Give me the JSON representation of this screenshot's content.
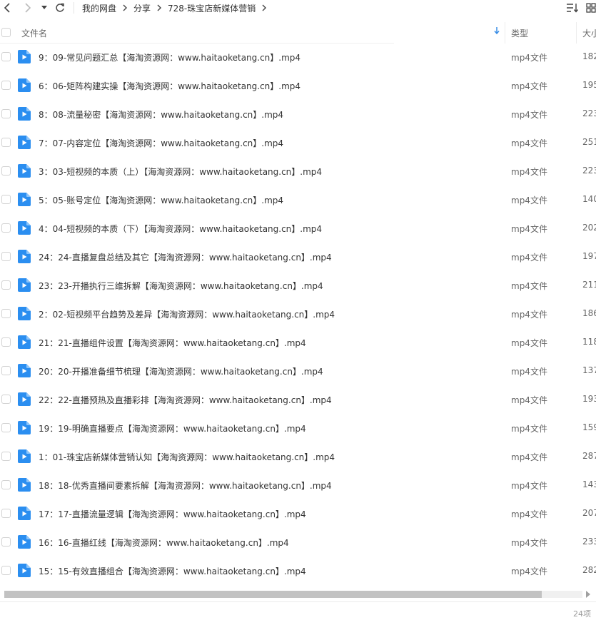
{
  "toolbar": {
    "breadcrumbs": [
      "我的网盘",
      "分享",
      "728-珠宝店新媒体营销"
    ]
  },
  "header": {
    "name_label": "文件名",
    "type_label": "类型",
    "size_label": "大小"
  },
  "files": [
    {
      "name": "9：09-常见问题汇总【海淘资源网：www.haitaoketang.cn】.mp4",
      "type": "mp4文件",
      "size": "182"
    },
    {
      "name": "6：06-矩阵构建实操【海淘资源网：www.haitaoketang.cn】.mp4",
      "type": "mp4文件",
      "size": "195"
    },
    {
      "name": "8：08-流量秘密【海淘资源网：www.haitaoketang.cn】.mp4",
      "type": "mp4文件",
      "size": "223"
    },
    {
      "name": "7：07-内容定位【海淘资源网：www.haitaoketang.cn】.mp4",
      "type": "mp4文件",
      "size": "251"
    },
    {
      "name": "3：03-短视频的本质（上）【海淘资源网：www.haitaoketang.cn】.mp4",
      "type": "mp4文件",
      "size": "223"
    },
    {
      "name": "5：05-账号定位【海淘资源网：www.haitaoketang.cn】.mp4",
      "type": "mp4文件",
      "size": "140"
    },
    {
      "name": "4：04-短视频的本质（下）【海淘资源网：www.haitaoketang.cn】.mp4",
      "type": "mp4文件",
      "size": "202"
    },
    {
      "name": "24：24-直播复盘总结及其它【海淘资源网：www.haitaoketang.cn】.mp4",
      "type": "mp4文件",
      "size": "197"
    },
    {
      "name": "23：23-开播执行三维拆解【海淘资源网：www.haitaoketang.cn】.mp4",
      "type": "mp4文件",
      "size": "211"
    },
    {
      "name": "2：02-短视频平台趋势及差异【海淘资源网：www.haitaoketang.cn】.mp4",
      "type": "mp4文件",
      "size": "186"
    },
    {
      "name": "21：21-直播组件设置【海淘资源网：www.haitaoketang.cn】.mp4",
      "type": "mp4文件",
      "size": "118"
    },
    {
      "name": "20：20-开播准备细节梳理【海淘资源网：www.haitaoketang.cn】.mp4",
      "type": "mp4文件",
      "size": "137"
    },
    {
      "name": "22：22-直播预热及直播彩排【海淘资源网：www.haitaoketang.cn】.mp4",
      "type": "mp4文件",
      "size": "193"
    },
    {
      "name": "19：19-明确直播要点【海淘资源网：www.haitaoketang.cn】.mp4",
      "type": "mp4文件",
      "size": "159"
    },
    {
      "name": "1：01-珠宝店新媒体营销认知【海淘资源网：www.haitaoketang.cn】.mp4",
      "type": "mp4文件",
      "size": "287"
    },
    {
      "name": "18：18-优秀直播间要素拆解【海淘资源网：www.haitaoketang.cn】.mp4",
      "type": "mp4文件",
      "size": "143"
    },
    {
      "name": "17：17-直播流量逻辑【海淘资源网：www.haitaoketang.cn】.mp4",
      "type": "mp4文件",
      "size": "207"
    },
    {
      "name": "16：16-直播红线【海淘资源网：www.haitaoketang.cn】.mp4",
      "type": "mp4文件",
      "size": "233"
    },
    {
      "name": "15：15-有效直播组合【海淘资源网：www.haitaoketang.cn】.mp4",
      "type": "mp4文件",
      "size": "282"
    }
  ],
  "status": {
    "count": "24项"
  },
  "icons": {
    "back": "back-arrow-icon",
    "forward": "forward-arrow-icon",
    "dropdown": "dropdown-caret-icon",
    "refresh": "refresh-icon",
    "sort": "sort-list-icon",
    "view": "grid-view-icon",
    "file": "video-file-icon"
  },
  "colors": {
    "file_icon": "#2b8ef0",
    "sort_arrow": "#3a8ee6"
  }
}
